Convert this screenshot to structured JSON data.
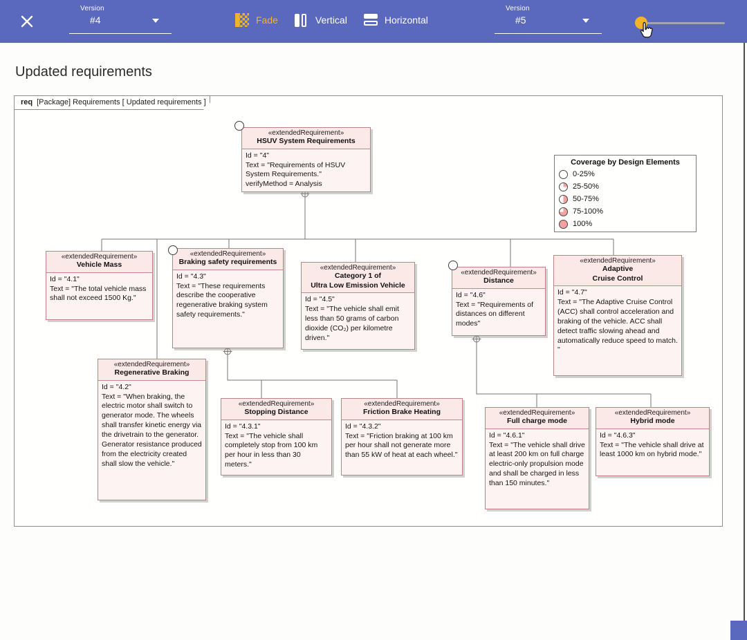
{
  "toolbar": {
    "background_color": "#5a68be",
    "accent_color": "#f0b429",
    "close_icon": "x-close",
    "version_left": {
      "label": "Version",
      "value": "#4"
    },
    "version_right": {
      "label": "Version",
      "value": "#5"
    },
    "fade_button": {
      "label": "Fade",
      "icon": "fade-checker-icon",
      "active_color": "#f0b429"
    },
    "vertical_button": {
      "label": "Vertical",
      "icon": "split-vertical-icon"
    },
    "horizontal_button": {
      "label": "Horizontal",
      "icon": "split-horizontal-icon"
    },
    "opacity_slider": {
      "position_percent": 4,
      "thumb_color": "#f0b429"
    }
  },
  "page": {
    "title": "Updated requirements"
  },
  "frame": {
    "tab_keyword": "req",
    "tab_text": "[Package] Requirements [ Updated requirements  ]"
  },
  "legend": {
    "title": "Coverage by Design Elements",
    "items": [
      {
        "label": "0-25%",
        "fill_percent": 0
      },
      {
        "label": "25-50%",
        "fill_percent": 25
      },
      {
        "label": "50-75%",
        "fill_percent": 50
      },
      {
        "label": "75-100%",
        "fill_percent": 75
      },
      {
        "label": "100%",
        "fill_percent": 100
      }
    ],
    "fill_color": "#f2a0a0"
  },
  "requirements": [
    {
      "stereotype": "«extendedRequirement»",
      "name": "HSUV System Requirements",
      "body": "Id = \"4\"\nText = \"Requirements of HSUV System Requirements.\"\nverifyMethod = Analysis"
    },
    {
      "stereotype": "«extendedRequirement»",
      "name": "Vehicle Mass",
      "body": "Id = \"4.1\"\nText = \"The total vehicle mass shall not exceed 1500 Kg.\""
    },
    {
      "stereotype": "«extendedRequirement»",
      "name": "Braking safety requirements",
      "body": "Id = \"4.3\"\nText = \"These requirements describe the cooperative regenerative braking system safety requirements.\""
    },
    {
      "stereotype": "«extendedRequirement»",
      "name": "Category 1 of\nUltra Low Emission Vehicle",
      "body": "Id = \"4.5\"\nText = \"The vehicle shall emit less than 50 grams of carbon dioxide (CO₂) per kilometre driven.\""
    },
    {
      "stereotype": "«extendedRequirement»",
      "name": "Distance",
      "body": "Id = \"4.6\"\nText = \"Requirements of distances on different modes\""
    },
    {
      "stereotype": "«extendedRequirement»",
      "name": "Adaptive\nCruise Control",
      "body": "Id = \"4.7\"\nText = \"The Adaptive Cruise Control (ACC) shall control acceleration and braking of the vehicle. ACC shall detect traffic slowing ahead and automatically reduce speed to match. \""
    },
    {
      "stereotype": "«extendedRequirement»",
      "name": "Regenerative Braking",
      "body": "Id = \"4.2\"\nText = \"When braking, the electric motor shall switch to generator mode. The wheels shall transfer kinetic energy via the drivetrain to the generator. Generator resistance produced from the electricity created shall slow the vehicle.\""
    },
    {
      "stereotype": "«extendedRequirement»",
      "name": "Stopping Distance",
      "body": "Id = \"4.3.1\"\nText = \"The vehicle shall completely stop from 100 km per hour in less than 30 meters.\""
    },
    {
      "stereotype": "«extendedRequirement»",
      "name": "Friction Brake Heating",
      "body": "Id = \"4.3.2\"\nText = \"Friction braking at 100 km per hour shall not generate more than 55 kW of heat at each wheel.\""
    },
    {
      "stereotype": "«extendedRequirement»",
      "name": "Full charge mode",
      "body": "Id = \"4.6.1\"\nText = \"The vehicle shall drive at least 200 km on full charge electric-only propulsion mode and shall be charged in less than 150 minutes.\""
    },
    {
      "stereotype": "«extendedRequirement»",
      "name": "Hybrid mode",
      "body": "Id = \"4.6.3\"\nText = \"The vehicle shall drive at least 1000 km on hybrid mode.\""
    }
  ]
}
